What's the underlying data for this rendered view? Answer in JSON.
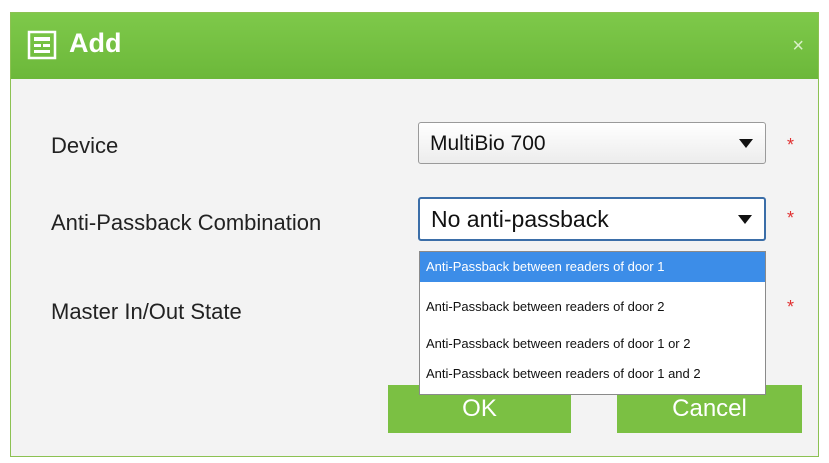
{
  "dialog": {
    "title": "Add",
    "close_glyph": "×"
  },
  "form": {
    "device_label": "Device",
    "device_value": "MultiBio 700",
    "combination_label": "Anti-Passback Combination",
    "combination_value": "No anti-passback",
    "master_label": "Master In/Out State",
    "required_mark": "*"
  },
  "dropdown": {
    "options": [
      "Anti-Passback between readers of door 1",
      "Anti-Passback between readers of door 2",
      "Anti-Passback between readers of door 1 or 2",
      "Anti-Passback between readers of door 1 and 2"
    ],
    "highlighted_index": 0
  },
  "buttons": {
    "ok": "OK",
    "cancel": "Cancel"
  },
  "colors": {
    "titlebar": "#72c03f",
    "button": "#7bc043",
    "highlight": "#3c8de8",
    "required": "#e03030"
  },
  "icons": {
    "title": "add-form-icon",
    "close": "close-icon",
    "dropdown": "chevron-down-icon"
  }
}
